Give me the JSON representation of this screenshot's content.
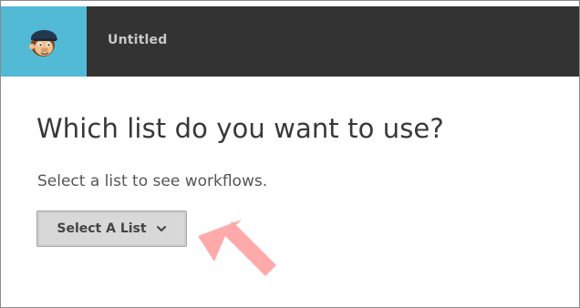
{
  "app": {
    "logo_icon": "mailchimp-freddie-icon",
    "accent_color": "#52bad5",
    "header_color": "#333333"
  },
  "header": {
    "title": "Untitled"
  },
  "main": {
    "heading": "Which list do you want to use?",
    "subtext": "Select a list to see workflows.",
    "select_button": {
      "label": "Select A List",
      "icon": "chevron-down-icon"
    }
  },
  "annotation": {
    "icon": "pointer-arrow-icon",
    "color": "#ffaaaa"
  }
}
